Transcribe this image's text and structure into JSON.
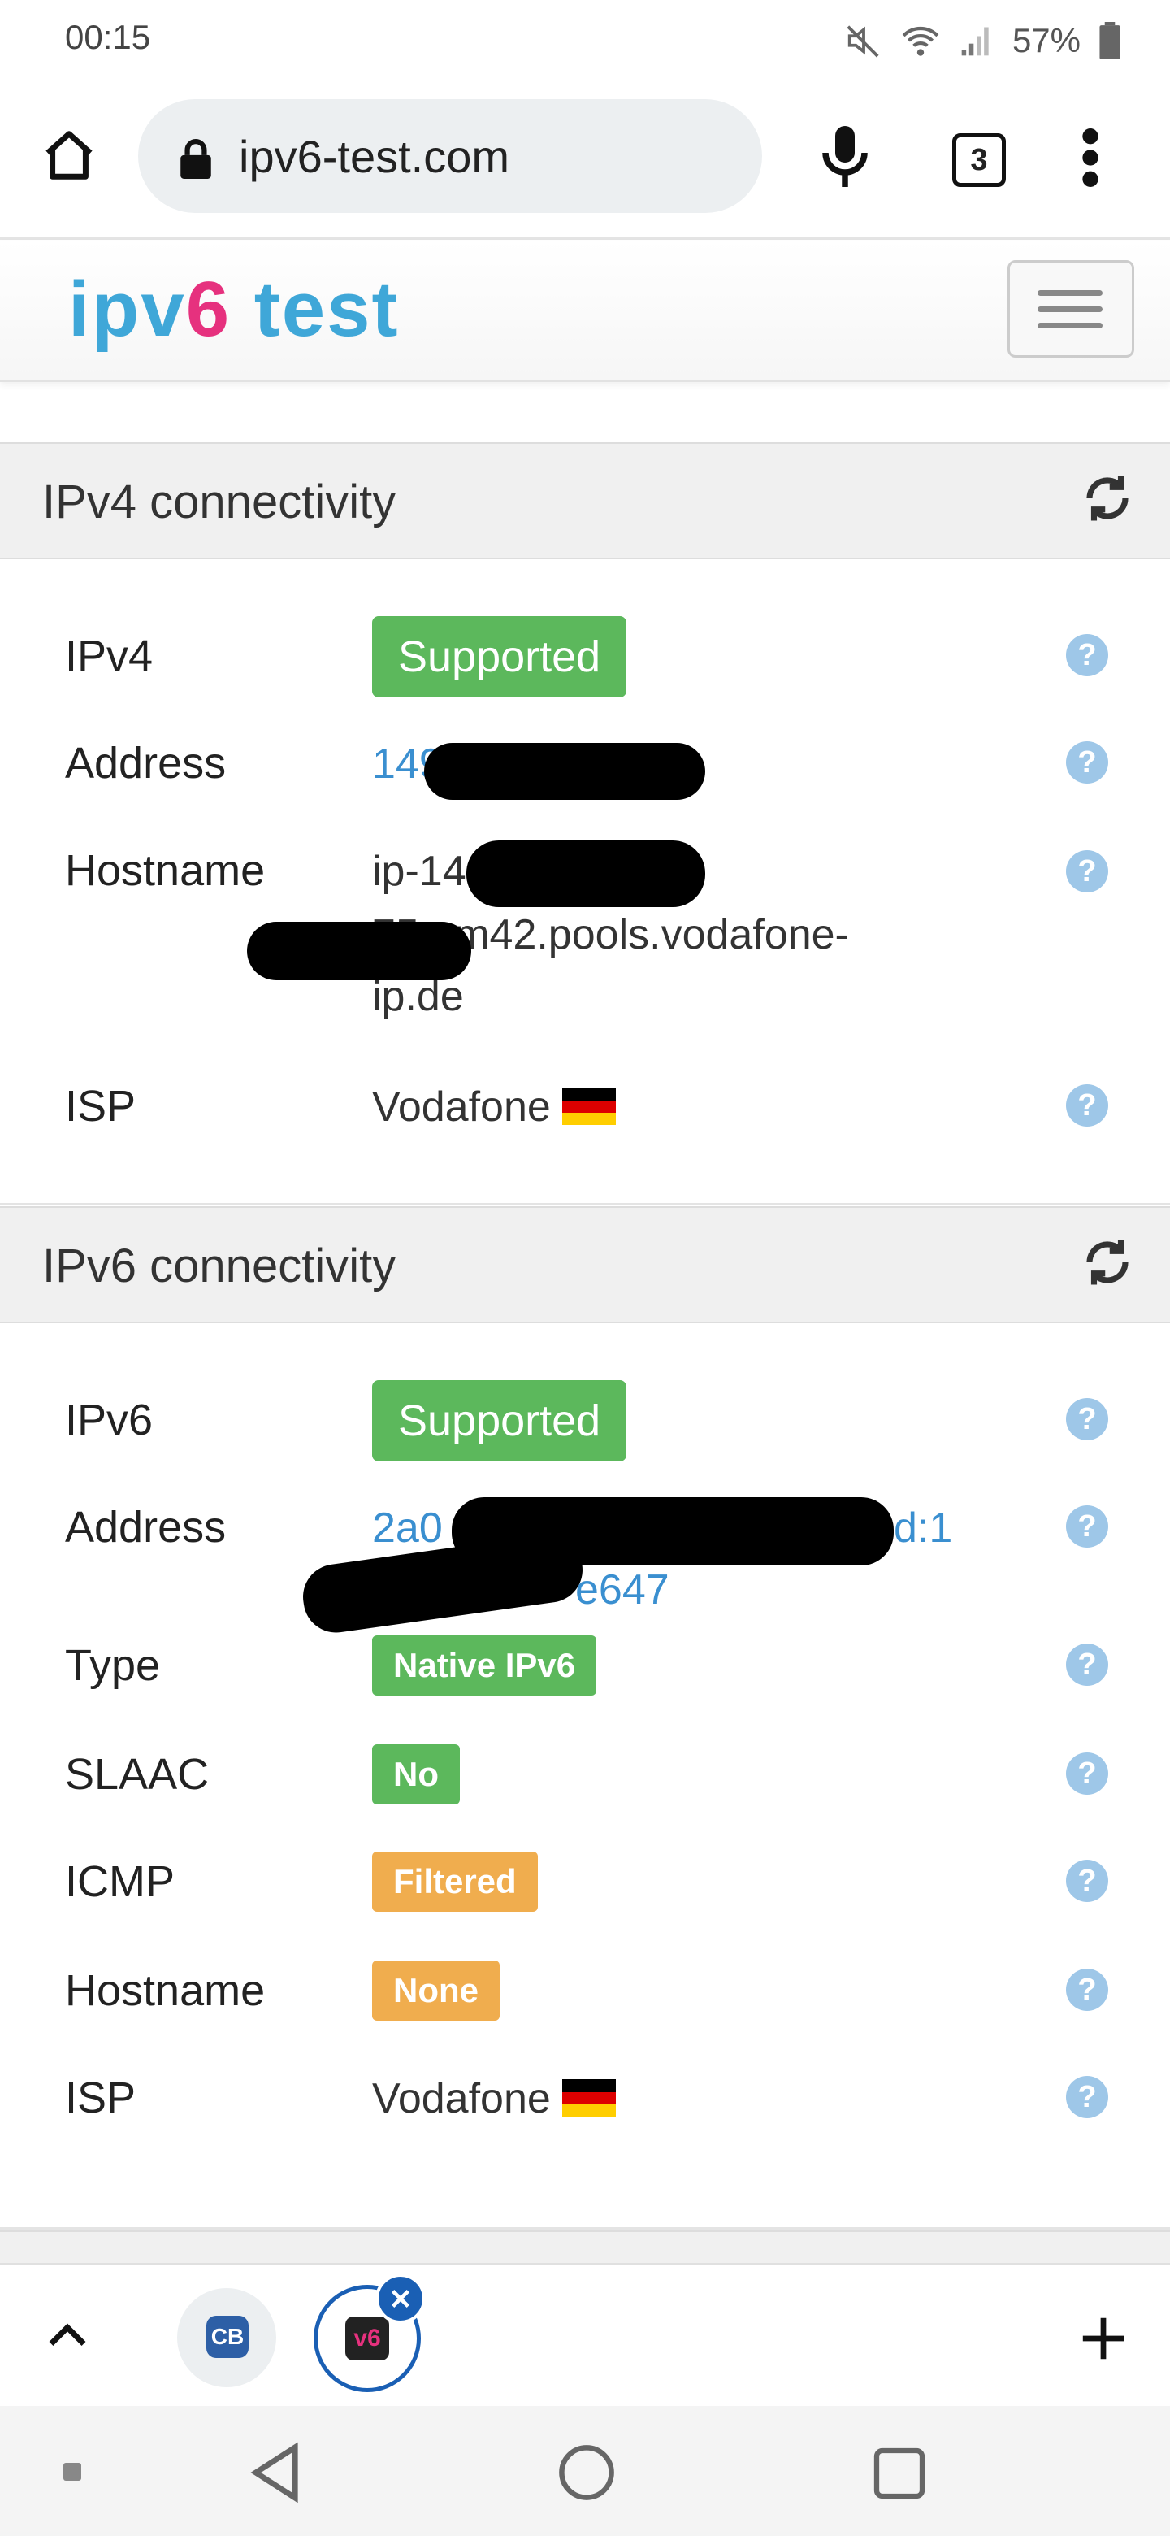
{
  "status": {
    "time": "00:15",
    "battery": "57%"
  },
  "browser": {
    "url": "ipv6-test.com",
    "tab_count": "3"
  },
  "site": {
    "logo_ip": "ip",
    "logo_v": "v",
    "logo_six": "6",
    "logo_test": " test"
  },
  "ipv4": {
    "title": "IPv4 connectivity",
    "rows": {
      "ipv4_label": "IPv4",
      "ipv4_value": "Supported",
      "address_label": "Address",
      "address_value": "149.172.10_.__5",
      "hostname_label": "Hostname",
      "hostname_line1": "ip-14",
      "hostname_line2": "75.um42.pools.vodafone-",
      "hostname_line3": "ip.de",
      "isp_label": "ISP",
      "isp_value": "Vodafone"
    }
  },
  "ipv6": {
    "title": "IPv6 connectivity",
    "rows": {
      "ipv6_label": "IPv6",
      "ipv6_value": "Supported",
      "address_label": "Address",
      "address_line1": "2a0",
      "address_line1_end": "d:1",
      "address_line2": "e647",
      "type_label": "Type",
      "type_value": "Native IPv6",
      "slaac_label": "SLAAC",
      "slaac_value": "No",
      "icmp_label": "ICMP",
      "icmp_value": "Filtered",
      "hostname_label": "Hostname",
      "hostname_value": "None",
      "isp_label": "ISP",
      "isp_value": "Vodafone"
    }
  },
  "flag_colors": [
    "#000000",
    "#dd0000",
    "#ffce00"
  ],
  "flag_code": "DE",
  "help_glyph": "?",
  "bottom": {
    "cb_label": "CB",
    "v6_label": "v6"
  }
}
